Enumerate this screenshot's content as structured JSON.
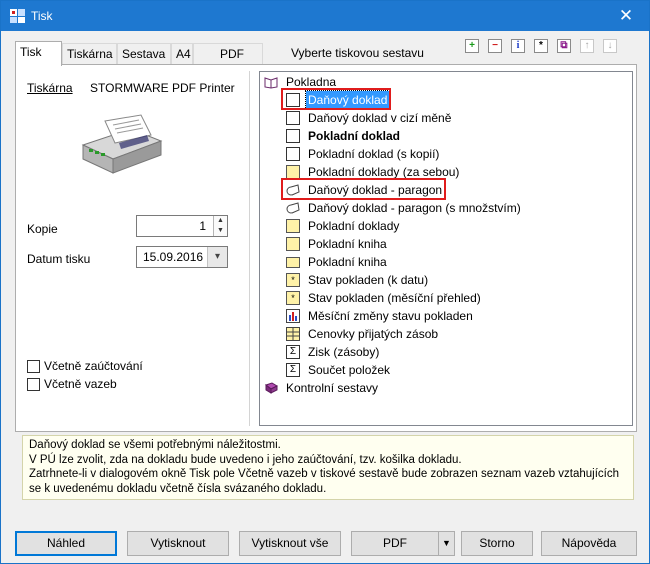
{
  "window": {
    "title": "Tisk",
    "close_glyph": "✕"
  },
  "tabs": [
    "Tisk",
    "Tiskárna",
    "Sestava",
    "A4",
    "PDF"
  ],
  "section_label": "Vyberte tiskovou sestavu",
  "toolbar_icons": [
    "add-icon",
    "remove-icon",
    "info-icon",
    "settings-icon",
    "copy-icon",
    "move-up-icon",
    "move-down-icon"
  ],
  "printer": {
    "label": "Tiskárna",
    "name": "STORMWARE PDF Printer"
  },
  "copies": {
    "label": "Kopie",
    "value": "1"
  },
  "print_date": {
    "label": "Datum tisku",
    "value": "15.09.2016"
  },
  "options": [
    {
      "label": "Včetně zaúčtování",
      "checked": false
    },
    {
      "label": "Včetně vazeb",
      "checked": false
    }
  ],
  "tree": {
    "root": "Pokladna",
    "items": [
      {
        "label": "Daňový doklad",
        "icon": "document-icon",
        "selected": true,
        "bold": false
      },
      {
        "label": "Daňový doklad v cizí měně",
        "icon": "document-icon",
        "selected": false,
        "bold": false
      },
      {
        "label": "Pokladní doklad",
        "icon": "document-icon",
        "selected": false,
        "bold": true
      },
      {
        "label": "Pokladní doklad (s kopií)",
        "icon": "document-icon",
        "selected": false,
        "bold": false
      },
      {
        "label": "Pokladní doklady (za sebou)",
        "icon": "yellow-document-icon",
        "selected": false,
        "bold": false
      },
      {
        "label": "Daňový doklad - paragon",
        "icon": "receipt-roll-icon",
        "selected": false,
        "bold": false
      },
      {
        "label": "Daňový doklad - paragon (s množstvím)",
        "icon": "receipt-roll-icon",
        "selected": false,
        "bold": false
      },
      {
        "label": "Pokladní doklady",
        "icon": "yellow-document-icon",
        "selected": false,
        "bold": false
      },
      {
        "label": "Pokladní kniha",
        "icon": "yellow-document-icon",
        "selected": false,
        "bold": false
      },
      {
        "label": "Pokladní kniha",
        "icon": "yellow-landscape-icon",
        "selected": false,
        "bold": false
      },
      {
        "label": "Stav pokladen (k datu)",
        "icon": "star-document-icon",
        "selected": false,
        "bold": false
      },
      {
        "label": "Stav pokladen (měsíční přehled)",
        "icon": "star-document-icon",
        "selected": false,
        "bold": false
      },
      {
        "label": "Měsíční změny stavu pokladen",
        "icon": "chart-document-icon",
        "selected": false,
        "bold": false
      },
      {
        "label": "Cenovky přijatých zásob",
        "icon": "grid-document-icon",
        "selected": false,
        "bold": false
      },
      {
        "label": "Zisk (zásoby)",
        "icon": "sum-document-icon",
        "selected": false,
        "bold": false
      },
      {
        "label": "Součet položek",
        "icon": "sum-document-icon",
        "selected": false,
        "bold": false
      }
    ],
    "second_root": "Kontrolní sestavy"
  },
  "description": [
    "Daňový doklad se všemi potřebnými náležitostmi.",
    "V PÚ lze zvolit, zda na dokladu bude uvedeno i jeho zaúčtování, tzv. košilka dokladu.",
    "Zatrhnete-li v dialogovém okně Tisk pole Včetně vazeb v tiskové sestavě bude zobrazen seznam vazeb vztahujících",
    "se k uvedenému dokladu včetně čísla svázaného dokladu."
  ],
  "buttons": {
    "preview": "Náhled",
    "print": "Vytisknout",
    "print_all": "Vytisknout vše",
    "pdf": "PDF",
    "cancel": "Storno",
    "help": "Nápověda"
  }
}
